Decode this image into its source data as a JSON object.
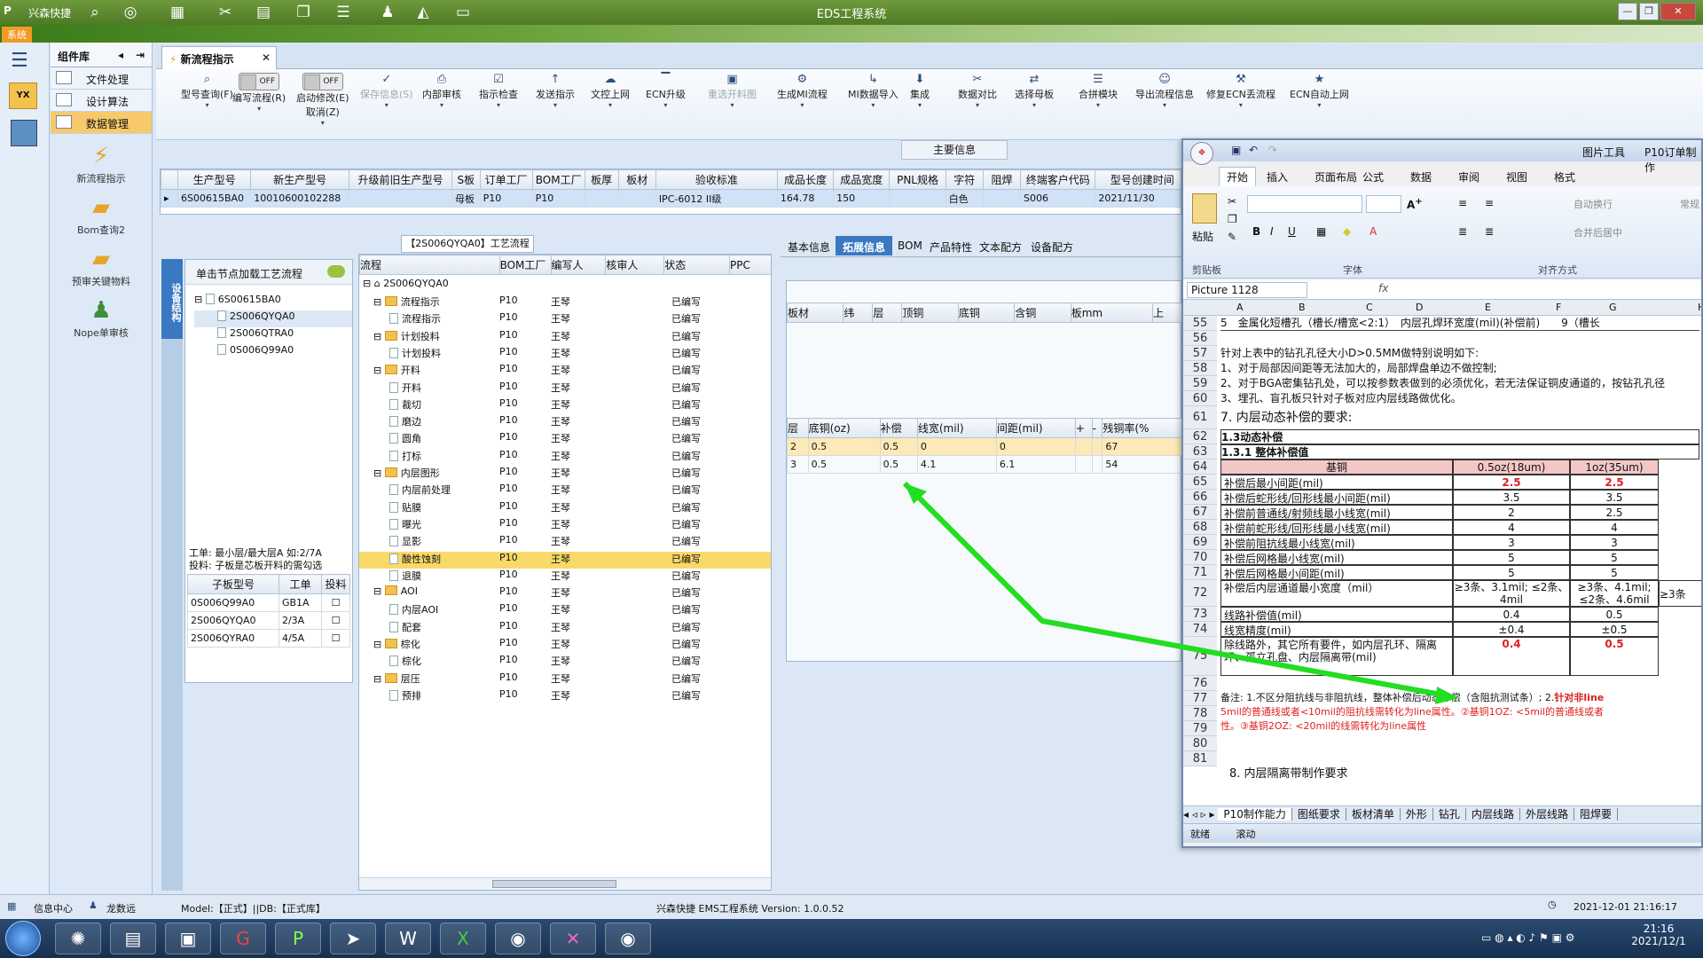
{
  "window": {
    "title": "EDS工程系统",
    "app_name": "兴森快捷",
    "system_label": "系统"
  },
  "components": {
    "title": "组件库",
    "items": [
      {
        "label": "文件处理"
      },
      {
        "label": "设计算法"
      },
      {
        "label": "数据管理"
      }
    ],
    "tools": [
      {
        "label": "新流程指示",
        "icon": "lightning-icon"
      },
      {
        "label": "Bom查询2",
        "icon": "folder-icon"
      },
      {
        "label": "预审关键物料",
        "icon": "folder-icon"
      },
      {
        "label": "Nope单审核",
        "icon": "user-icon"
      }
    ]
  },
  "tab": {
    "label": "新流程指示"
  },
  "toolbar": [
    {
      "label": "型号查询(F)",
      "icon": "⌕"
    },
    {
      "label": "编写流程(R)",
      "toggle": "OFF"
    },
    {
      "label": "启动修改(E)",
      "label2": "取消(Z)",
      "toggle": "OFF"
    },
    {
      "label": "保存信息(S)",
      "icon": "✓",
      "disabled": true
    },
    {
      "label": "内部审核",
      "icon": "⎙"
    },
    {
      "label": "指示检查",
      "icon": "☑"
    },
    {
      "label": "发送指示",
      "icon": "↑"
    },
    {
      "label": "文控上网",
      "icon": "☁"
    },
    {
      "label": "ECN升级",
      "icon": "▔"
    },
    {
      "label": "重选开料图",
      "icon": "▣",
      "disabled": true
    },
    {
      "label": "生成MI流程",
      "icon": "⚙"
    },
    {
      "label": "MI数据导入",
      "icon": "↳"
    },
    {
      "label": "集成",
      "icon": "⬇"
    },
    {
      "label": "数据对比",
      "icon": "✂"
    },
    {
      "label": "选择母板",
      "icon": "⇄"
    },
    {
      "label": "合拼模块",
      "icon": "☰"
    },
    {
      "label": "导出流程信息",
      "icon": "☺"
    },
    {
      "label": "修复ECN丢流程",
      "icon": "⚒"
    },
    {
      "label": "ECN自动上网",
      "icon": "★"
    }
  ],
  "main_info": {
    "title": "主要信息",
    "headers": [
      "生产型号",
      "新生产型号",
      "升级前旧生产型号",
      "S板",
      "订单工厂",
      "BOM工厂",
      "板厚",
      "板材",
      "验收标准",
      "成品长度",
      "成品宽度",
      "PNL规格",
      "字符",
      "阻焊",
      "终端客户代码",
      "型号创建时间"
    ],
    "row": [
      "6S00615BA0",
      "10010600102288",
      "",
      "母板",
      "P10",
      "P10",
      "",
      "",
      "IPC-6012 II级",
      "164.78",
      "150",
      "",
      "白色",
      "",
      "S006",
      "2021/11/30"
    ]
  },
  "process_title": "【2S006QYQA0】工艺流程",
  "side_tab": "设备结构",
  "tree_panel": {
    "hint": "单击节点加载工艺流程",
    "root": "6S00615BA0",
    "children": [
      "2S006QYQA0",
      "2S006QTRA0",
      "0S006Q99A0"
    ],
    "note1": "工单: 最小层/最大层A 如:2/7A",
    "note2": "投料: 子板是芯板开料的需勾选",
    "sub_headers": [
      "子板型号",
      "工单",
      "投料"
    ],
    "sub_rows": [
      [
        "0S006Q99A0",
        "GB1A"
      ],
      [
        "2S006QYQA0",
        "2/3A"
      ],
      [
        "2S006QYRA0",
        "4/5A"
      ]
    ]
  },
  "flow": {
    "headers": [
      "流程",
      "BOM工厂",
      "编写人",
      "核审人",
      "状态",
      "PPC"
    ],
    "root": "2S006QYQA0",
    "rows": [
      {
        "name": "流程指示",
        "level": 1,
        "folder": true,
        "factory": "P10",
        "writer": "王琴",
        "status": "已编写"
      },
      {
        "name": "流程指示",
        "level": 2,
        "factory": "P10",
        "writer": "王琴",
        "status": "已编写"
      },
      {
        "name": "计划投料",
        "level": 1,
        "folder": true,
        "factory": "P10",
        "writer": "王琴",
        "status": "已编写"
      },
      {
        "name": "计划投料",
        "level": 2,
        "factory": "P10",
        "writer": "王琴",
        "status": "已编写"
      },
      {
        "name": "开料",
        "level": 1,
        "folder": true,
        "factory": "P10",
        "writer": "王琴",
        "status": "已编写"
      },
      {
        "name": "开料",
        "level": 2,
        "factory": "P10",
        "writer": "王琴",
        "status": "已编写"
      },
      {
        "name": "裁切",
        "level": 2,
        "factory": "P10",
        "writer": "王琴",
        "status": "已编写"
      },
      {
        "name": "磨边",
        "level": 2,
        "factory": "P10",
        "writer": "王琴",
        "status": "已编写"
      },
      {
        "name": "圆角",
        "level": 2,
        "factory": "P10",
        "writer": "王琴",
        "status": "已编写"
      },
      {
        "name": "打标",
        "level": 2,
        "factory": "P10",
        "writer": "王琴",
        "status": "已编写"
      },
      {
        "name": "内层图形",
        "level": 1,
        "folder": true,
        "factory": "P10",
        "writer": "王琴",
        "status": "已编写"
      },
      {
        "name": "内层前处理",
        "level": 2,
        "factory": "P10",
        "writer": "王琴",
        "status": "已编写"
      },
      {
        "name": "贴膜",
        "level": 2,
        "factory": "P10",
        "writer": "王琴",
        "status": "已编写"
      },
      {
        "name": "曝光",
        "level": 2,
        "factory": "P10",
        "writer": "王琴",
        "status": "已编写"
      },
      {
        "name": "显影",
        "level": 2,
        "factory": "P10",
        "writer": "王琴",
        "status": "已编写"
      },
      {
        "name": "酸性蚀刻",
        "level": 2,
        "factory": "P10",
        "writer": "王琴",
        "status": "已编写",
        "selected": true
      },
      {
        "name": "退膜",
        "level": 2,
        "factory": "P10",
        "writer": "王琴",
        "status": "已编写"
      },
      {
        "name": "AOI",
        "level": 1,
        "folder": true,
        "factory": "P10",
        "writer": "王琴",
        "status": "已编写"
      },
      {
        "name": "内层AOI",
        "level": 2,
        "factory": "P10",
        "writer": "王琴",
        "status": "已编写"
      },
      {
        "name": "配套",
        "level": 2,
        "factory": "P10",
        "writer": "王琴",
        "status": "已编写"
      },
      {
        "name": "棕化",
        "level": 1,
        "folder": true,
        "factory": "P10",
        "writer": "王琴",
        "status": "已编写"
      },
      {
        "name": "棕化",
        "level": 2,
        "factory": "P10",
        "writer": "王琴",
        "status": "已编写"
      },
      {
        "name": "层压",
        "level": 1,
        "folder": true,
        "factory": "P10",
        "writer": "王琴",
        "status": "已编写"
      },
      {
        "name": "预排",
        "level": 2,
        "factory": "P10",
        "writer": "王琴",
        "status": "已编写"
      }
    ]
  },
  "content_tabs": [
    "基本信息",
    "拓展信息",
    "BOM",
    "产品特性",
    "文本配方",
    "设备配方"
  ],
  "board_headers": [
    "板材",
    "纬",
    "层",
    "顶铜",
    "底铜",
    "含铜",
    "板mm",
    "上"
  ],
  "layer_headers": [
    "层",
    "底铜(oz)",
    "补偿",
    "线宽(mil)",
    "间距(mil)",
    "+",
    "-",
    "残铜率(%"
  ],
  "layer_rows": [
    [
      "2",
      "0.5",
      "0.5",
      "0",
      "0",
      "",
      "",
      "67"
    ],
    [
      "3",
      "0.5",
      "0.5",
      "4.1",
      "6.1",
      "",
      "",
      "54"
    ]
  ],
  "excel": {
    "title_tools": "图片工具",
    "title_file": "P10订单制作",
    "ribbon_tabs": [
      "开始",
      "插入",
      "页面布局",
      "公式",
      "数据",
      "审阅",
      "视图",
      "格式"
    ],
    "groups": [
      "剪贴板",
      "字体",
      "对齐方式"
    ],
    "paste": "粘贴",
    "auto_wrap": "自动换行",
    "merge": "合并后居中",
    "number": "常规",
    "name_box": "Picture 1128",
    "fx": "fx",
    "cols": [
      "A",
      "B",
      "C",
      "D",
      "E",
      "F",
      "G",
      "H"
    ],
    "rows": [
      {
        "n": "55",
        "text": "5　金属化短槽孔（槽长/槽宽<2:1）　内层孔焊环宽度(mil)(补偿前)　　9（槽长"
      },
      {
        "n": "56",
        "text": ""
      },
      {
        "n": "57",
        "text": "针对上表中的钻孔孔径大小D>0.5MM做特别说明如下:"
      },
      {
        "n": "58",
        "text": "1、对于局部因间距等无法加大的，局部焊盘单边不做控制;"
      },
      {
        "n": "59",
        "text": "2、对于BGA密集钻孔处，可以按参数表做到的必须优化，若无法保证铜皮通道的，按钻孔孔径"
      },
      {
        "n": "60",
        "text": "3、埋孔、盲孔板只针对子板对应内层线路做优化。"
      },
      {
        "n": "61",
        "text": "7. 内层动态补偿的要求:"
      },
      {
        "n": "62",
        "text": "1.3动态补偿"
      },
      {
        "n": "63",
        "text": "1.3.1 整体补偿值"
      }
    ],
    "comp_header": [
      "基铜",
      "0.5oz(18um)",
      "1oz(35um)"
    ],
    "comp_rows": [
      {
        "n": "64",
        "label": "",
        "a": "",
        "b": ""
      },
      {
        "n": "65",
        "label": "补偿后最小间距(mil)",
        "a": "2.5",
        "b": "2.5",
        "red": true
      },
      {
        "n": "66",
        "label": "补偿后蛇形线/回形线最小间距(mil)",
        "a": "3.5",
        "b": "3.5"
      },
      {
        "n": "67",
        "label": "补偿前普通线/射频线最小线宽(mil)",
        "a": "2",
        "b": "2.5"
      },
      {
        "n": "68",
        "label": "补偿前蛇形线/回形线最小线宽(mil)",
        "a": "4",
        "b": "4"
      },
      {
        "n": "69",
        "label": "补偿前阻抗线最小线宽(mil)",
        "a": "3",
        "b": "3"
      },
      {
        "n": "70",
        "label": "补偿后网格最小线宽(mil)",
        "a": "5",
        "b": "5"
      },
      {
        "n": "71",
        "label": "补偿后网格最小间距(mil)",
        "a": "5",
        "b": "5"
      },
      {
        "n": "72",
        "label": "补偿后内层通道最小宽度（mil）",
        "a": "≥3条、3.1mil; ≤2条、4mil",
        "b": "≥3条、4.1mil; ≤2条、4.6mil",
        "c": "≥3条"
      },
      {
        "n": "73",
        "label": "线路补偿值(mil)",
        "a": "0.4",
        "b": "0.5"
      },
      {
        "n": "74",
        "label": "线宽精度(mil)",
        "a": "±0.4",
        "b": "±0.5"
      },
      {
        "n": "75",
        "label": "除线路外，其它所有要件，如内层孔环、隔离环、孤立孔盘、内层隔离带(mil)",
        "a": "0.4",
        "b": "0.5",
        "red": true
      }
    ],
    "tail_rows": [
      "76",
      "77",
      "78",
      "79",
      "80",
      "81"
    ],
    "note_black": "备注: 1.不区分阻抗线与非阻抗线，整体补偿后动态补偿（含阻抗测试条）; 2.",
    "note_red_1": "针对非line",
    "note_red_2": "5mil的普通线或者<10mil的阻抗线需转化为line属性。②基铜1OZ: <5mil的普通线或者",
    "note_red_3": "性。③基铜2OZ: <20mil的线需转化为line属性",
    "row82": "8. 内层隔离带制作要求",
    "sheet_tabs": [
      "P10制作能力",
      "图纸要求",
      "板材清单",
      "外形",
      "钻孔",
      "内层线路",
      "外层线路",
      "阻焊要"
    ],
    "status": [
      "就绪",
      "滚动"
    ]
  },
  "status": {
    "info_center": "信息中心",
    "user": "龙数远",
    "model": "Model:【正式】||DB:【正式库】",
    "app": "兴森快捷  EMS工程系统  Version: 1.0.0.52",
    "datetime": "2021-12-01 21:16:17"
  },
  "clock": {
    "time": "21:16",
    "date": "2021/12/1"
  },
  "colors": {
    "accent": "#3a78c2",
    "highlight": "#f9d96a",
    "arrow": "#22dd22",
    "red": "#e02020"
  }
}
